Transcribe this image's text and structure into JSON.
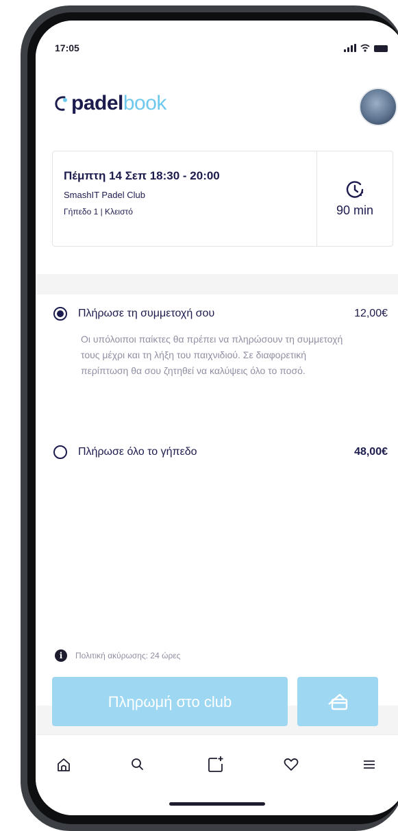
{
  "status_bar": {
    "time": "17:05"
  },
  "app": {
    "logo_part1": "padel",
    "logo_part2": "book"
  },
  "booking": {
    "title": "Πέμπτη 14 Σεπ 18:30 - 20:00",
    "club": "SmashIT Padel Club",
    "court": "Γήπεδο 1 | Κλειστό",
    "duration": "90 min"
  },
  "payment_options": [
    {
      "label": "Πλήρωσε τη συμμετοχή σου",
      "price": "12,00€",
      "selected": true,
      "description": "Οι υπόλοιποι παίκτες θα πρέπει να πληρώσουν τη συμμετοχή τους μέχρι και τη λήξη του παιχνιδιού. Σε διαφορετική περίπτωση θα σου ζητηθεί να καλύψεις όλο το ποσό."
    },
    {
      "label": "Πλήρωσε όλο το γήπεδο",
      "price": "48,00€",
      "selected": false
    }
  ],
  "policy": {
    "text": "Πολιτική ακύρωσης: 24 ώρες"
  },
  "actions": {
    "pay_label": "Πληρωμή στο club"
  },
  "colors": {
    "primary": "#1c1b4d",
    "accent": "#6ec8ee",
    "button": "#9ed7f2"
  },
  "icons": [
    "home-icon",
    "search-icon",
    "add-icon",
    "heart-icon",
    "menu-icon",
    "card-icon",
    "clock-icon",
    "info-icon"
  ]
}
